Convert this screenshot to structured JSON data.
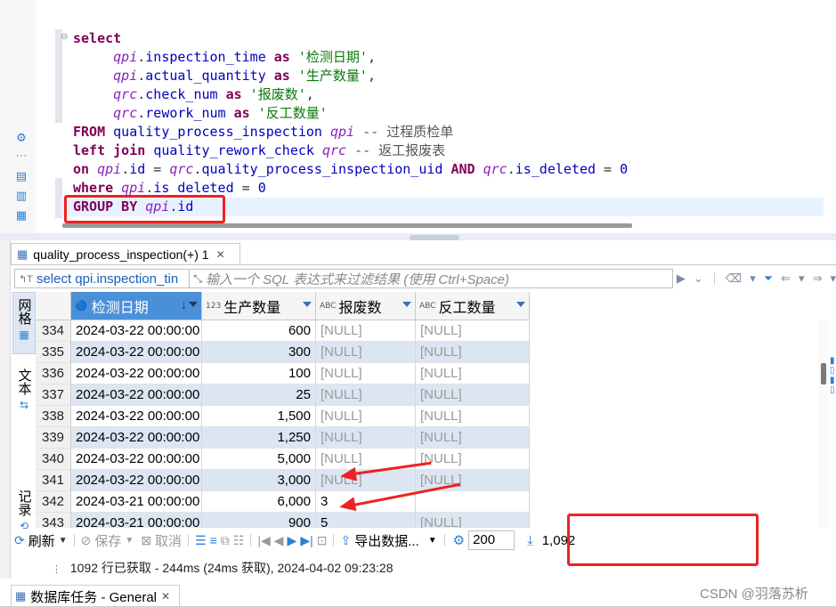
{
  "editor": {
    "lines": [
      [
        {
          "t": "select",
          "c": "kw"
        }
      ],
      [
        {
          "t": "     ",
          "c": "plain"
        },
        {
          "t": "qpi",
          "c": "alias"
        },
        {
          "t": ".",
          "c": "plain"
        },
        {
          "t": "inspection_time",
          "c": "ident"
        },
        {
          "t": " ",
          "c": "plain"
        },
        {
          "t": "as",
          "c": "kw"
        },
        {
          "t": " '检测日期'",
          "c": "str"
        },
        {
          "t": ",",
          "c": "plain"
        }
      ],
      [
        {
          "t": "     ",
          "c": "plain"
        },
        {
          "t": "qpi",
          "c": "alias"
        },
        {
          "t": ".",
          "c": "plain"
        },
        {
          "t": "actual_quantity",
          "c": "ident"
        },
        {
          "t": " ",
          "c": "plain"
        },
        {
          "t": "as",
          "c": "kw"
        },
        {
          "t": " '生产数量'",
          "c": "str"
        },
        {
          "t": ",",
          "c": "plain"
        }
      ],
      [
        {
          "t": "     ",
          "c": "plain"
        },
        {
          "t": "qrc",
          "c": "alias"
        },
        {
          "t": ".",
          "c": "plain"
        },
        {
          "t": "check_num",
          "c": "ident"
        },
        {
          "t": " ",
          "c": "plain"
        },
        {
          "t": "as",
          "c": "kw"
        },
        {
          "t": " '报废数'",
          "c": "str"
        },
        {
          "t": ",",
          "c": "plain"
        }
      ],
      [
        {
          "t": "     ",
          "c": "plain"
        },
        {
          "t": "qrc",
          "c": "alias"
        },
        {
          "t": ".",
          "c": "plain"
        },
        {
          "t": "rework_num",
          "c": "ident"
        },
        {
          "t": " ",
          "c": "plain"
        },
        {
          "t": "as",
          "c": "kw"
        },
        {
          "t": " '反工数量'",
          "c": "str"
        }
      ],
      [
        {
          "t": "FROM",
          "c": "kw"
        },
        {
          "t": " ",
          "c": "plain"
        },
        {
          "t": "quality_process_inspection",
          "c": "ident"
        },
        {
          "t": " ",
          "c": "plain"
        },
        {
          "t": "qpi",
          "c": "alias"
        },
        {
          "t": " -- 过程质检单",
          "c": "cmt"
        }
      ],
      [
        {
          "t": "left join",
          "c": "kw"
        },
        {
          "t": " ",
          "c": "plain"
        },
        {
          "t": "quality_rework_check",
          "c": "ident"
        },
        {
          "t": " ",
          "c": "plain"
        },
        {
          "t": "qrc",
          "c": "alias"
        },
        {
          "t": " -- 返工报废表",
          "c": "cmt"
        }
      ],
      [
        {
          "t": "on",
          "c": "kw"
        },
        {
          "t": " ",
          "c": "plain"
        },
        {
          "t": "qpi",
          "c": "alias"
        },
        {
          "t": ".",
          "c": "plain"
        },
        {
          "t": "id",
          "c": "ident"
        },
        {
          "t": " = ",
          "c": "plain"
        },
        {
          "t": "qrc",
          "c": "alias"
        },
        {
          "t": ".",
          "c": "plain"
        },
        {
          "t": "quality_process_inspection_uid",
          "c": "ident"
        },
        {
          "t": " ",
          "c": "plain"
        },
        {
          "t": "AND",
          "c": "kw"
        },
        {
          "t": " ",
          "c": "plain"
        },
        {
          "t": "qrc",
          "c": "alias"
        },
        {
          "t": ".",
          "c": "plain"
        },
        {
          "t": "is_deleted",
          "c": "ident"
        },
        {
          "t": " = ",
          "c": "plain"
        },
        {
          "t": "0",
          "c": "num"
        }
      ],
      [
        {
          "t": "where",
          "c": "kw"
        },
        {
          "t": " ",
          "c": "plain"
        },
        {
          "t": "qpi",
          "c": "alias"
        },
        {
          "t": ".",
          "c": "plain"
        },
        {
          "t": "is_deleted",
          "c": "ident"
        },
        {
          "t": " = ",
          "c": "plain"
        },
        {
          "t": "0",
          "c": "num"
        }
      ],
      [
        {
          "t": "GROUP BY",
          "c": "kw"
        },
        {
          "t": " ",
          "c": "plain"
        },
        {
          "t": "qpi",
          "c": "alias"
        },
        {
          "t": ".",
          "c": "plain"
        },
        {
          "t": "id",
          "c": "ident"
        }
      ]
    ]
  },
  "result_tab": {
    "label": "quality_process_inspection(+) 1",
    "close": "✕"
  },
  "filter": {
    "query_text": "select qpi.inspection_tin",
    "placeholder": "输入一个 SQL 表达式来过滤结果 (使用 Ctrl+Space)"
  },
  "side_tabs": {
    "grid": "网格",
    "text": "文本",
    "record": "记录"
  },
  "grid": {
    "columns": [
      {
        "label": "检测日期",
        "badge": "",
        "sorted": true
      },
      {
        "label": "生产数量",
        "badge": "123",
        "sorted": false
      },
      {
        "label": "报废数",
        "badge": "ABC",
        "sorted": false
      },
      {
        "label": "反工数量",
        "badge": "ABC",
        "sorted": false
      }
    ],
    "rows": [
      {
        "n": "334",
        "date": "2024-03-22 00:00:00",
        "qty": "600",
        "scrap": "[NULL]",
        "rework": "[NULL]"
      },
      {
        "n": "335",
        "date": "2024-03-22 00:00:00",
        "qty": "300",
        "scrap": "[NULL]",
        "rework": "[NULL]"
      },
      {
        "n": "336",
        "date": "2024-03-22 00:00:00",
        "qty": "100",
        "scrap": "[NULL]",
        "rework": "[NULL]"
      },
      {
        "n": "337",
        "date": "2024-03-22 00:00:00",
        "qty": "25",
        "scrap": "[NULL]",
        "rework": "[NULL]"
      },
      {
        "n": "338",
        "date": "2024-03-22 00:00:00",
        "qty": "1,500",
        "scrap": "[NULL]",
        "rework": "[NULL]"
      },
      {
        "n": "339",
        "date": "2024-03-22 00:00:00",
        "qty": "1,250",
        "scrap": "[NULL]",
        "rework": "[NULL]"
      },
      {
        "n": "340",
        "date": "2024-03-22 00:00:00",
        "qty": "5,000",
        "scrap": "[NULL]",
        "rework": "[NULL]"
      },
      {
        "n": "341",
        "date": "2024-03-22 00:00:00",
        "qty": "3,000",
        "scrap": "[NULL]",
        "rework": "[NULL]"
      },
      {
        "n": "342",
        "date": "2024-03-21 00:00:00",
        "qty": "6,000",
        "scrap": "3",
        "rework": ""
      },
      {
        "n": "343",
        "date": "2024-03-21 00:00:00",
        "qty": "900",
        "scrap": "5",
        "rework": "[NULL]"
      }
    ]
  },
  "toolbar": {
    "refresh": "刷新",
    "save": "保存",
    "cancel": "取消",
    "export": "导出数据...",
    "fetch_size": "200",
    "row_count": "1,092"
  },
  "status": {
    "text": "1092 行已获取 - 244ms (24ms 获取), 2024-04-02 09:23:28"
  },
  "bottom_tab": {
    "label": "数据库任务 - General",
    "close": "✕"
  },
  "watermark": "CSDN @羽落苏析",
  "colors": {
    "highlight_red": "#e22222",
    "sorted_header": "#4a90d9",
    "alt_row": "#dce6f2"
  }
}
